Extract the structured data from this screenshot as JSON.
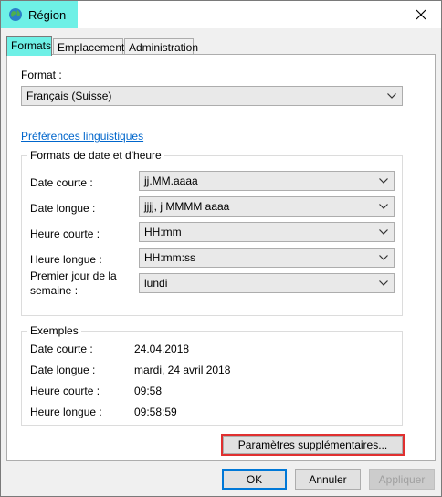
{
  "window": {
    "title": "Région"
  },
  "tabs": [
    {
      "label": "Formats",
      "active": true
    },
    {
      "label": "Emplacement",
      "active": false
    },
    {
      "label": "Administration",
      "active": false
    }
  ],
  "format": {
    "label": "Format :",
    "value": "Français (Suisse)"
  },
  "language_link": "Préférences linguistiques",
  "date_time_formats": {
    "title": "Formats de date et d'heure",
    "rows": [
      {
        "label": "Date courte :",
        "value": "jj.MM.aaaa"
      },
      {
        "label": "Date longue :",
        "value": "jjjj, j MMMM aaaa"
      },
      {
        "label": "Heure courte :",
        "value": "HH:mm"
      },
      {
        "label": "Heure longue :",
        "value": "HH:mm:ss"
      },
      {
        "label_line1": "Premier jour de la",
        "label_line2": "semaine :",
        "value": "lundi"
      }
    ]
  },
  "examples": {
    "title": "Exemples",
    "rows": [
      {
        "label": "Date courte :",
        "value": "24.04.2018"
      },
      {
        "label": "Date longue :",
        "value": "mardi, 24 avril 2018"
      },
      {
        "label": "Heure courte :",
        "value": "09:58"
      },
      {
        "label": "Heure longue :",
        "value": "09:58:59"
      }
    ]
  },
  "buttons": {
    "additional_settings": "Paramètres supplémentaires...",
    "ok": "OK",
    "cancel": "Annuler",
    "apply": "Appliquer"
  },
  "icons": {
    "app": "globe-icon",
    "close": "close-icon",
    "dropdown": "chevron-down-icon"
  },
  "colors": {
    "highlight": "#6ef0e6",
    "link": "#0066cc",
    "annotation": "#e03030",
    "default_button": "#0078d7"
  }
}
